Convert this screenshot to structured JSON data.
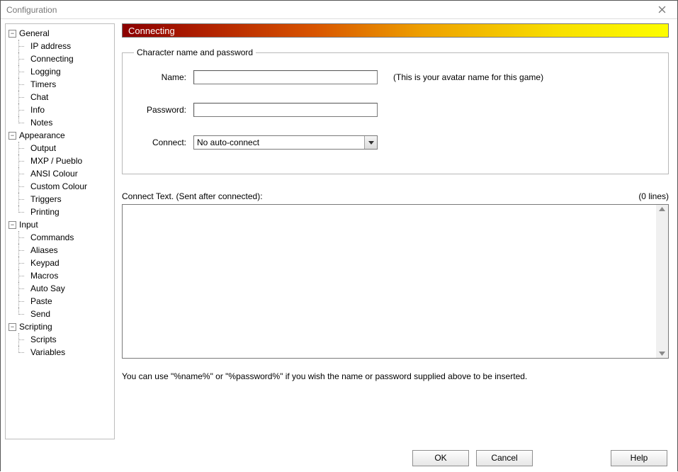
{
  "window": {
    "title": "Configuration"
  },
  "tree": {
    "general": {
      "label": "General",
      "items": [
        "IP address",
        "Connecting",
        "Logging",
        "Timers",
        "Chat",
        "Info",
        "Notes"
      ]
    },
    "appearance": {
      "label": "Appearance",
      "items": [
        "Output",
        "MXP / Pueblo",
        "ANSI Colour",
        "Custom Colour",
        "Triggers",
        "Printing"
      ]
    },
    "input": {
      "label": "Input",
      "items": [
        "Commands",
        "Aliases",
        "Keypad",
        "Macros",
        "Auto Say",
        "Paste",
        "Send"
      ]
    },
    "scripting": {
      "label": "Scripting",
      "items": [
        "Scripts",
        "Variables"
      ]
    }
  },
  "page": {
    "title": "Connecting",
    "group_legend": "Character name and password",
    "name_label": "Name:",
    "name_value": "",
    "name_hint": "(This is your avatar name for this game)",
    "password_label": "Password:",
    "password_value": "",
    "connect_label": "Connect:",
    "connect_selected": "No auto-connect",
    "connect_text_label": "Connect Text. (Sent after connected):",
    "connect_text_lines": "(0 lines)",
    "connect_text_value": "",
    "substitution_hint": "You can use \"%name%\" or \"%password%\" if you wish the name or password supplied above to be inserted."
  },
  "buttons": {
    "ok": "OK",
    "cancel": "Cancel",
    "help": "Help"
  }
}
